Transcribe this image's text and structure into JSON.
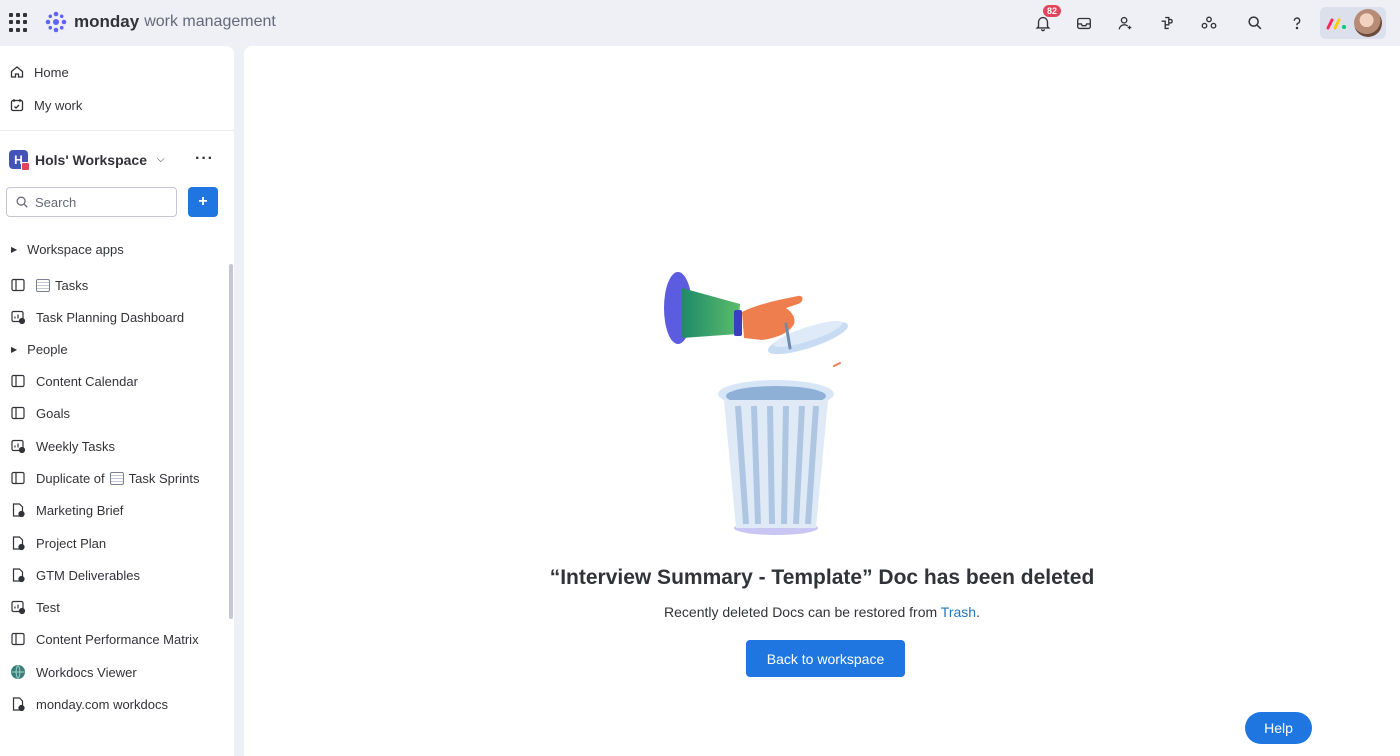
{
  "header": {
    "brand_bold": "monday",
    "brand_light": "work management",
    "notification_count": "82",
    "icons": [
      "apps-grid-icon",
      "bell-icon",
      "inbox-icon",
      "invite-user-icon",
      "integrations-icon",
      "marketplace-icon",
      "search-icon",
      "help-icon"
    ]
  },
  "sidebar": {
    "nav": [
      {
        "label": "Home",
        "icon": "home-icon"
      },
      {
        "label": "My work",
        "icon": "my-work-icon"
      }
    ],
    "workspace": {
      "initial": "H",
      "name": "Hols' Workspace"
    },
    "search": {
      "placeholder": "Search"
    },
    "add_label": "+",
    "items": [
      {
        "label": "Workspace apps",
        "type": "folder"
      },
      {
        "label": "Tasks",
        "type": "board",
        "has_board_emoji": true
      },
      {
        "label": "Task Planning Dashboard",
        "type": "dashboard"
      },
      {
        "label": "People",
        "type": "folder"
      },
      {
        "label": "Content Calendar",
        "type": "board"
      },
      {
        "label": "Goals",
        "type": "board"
      },
      {
        "label": "Weekly Tasks",
        "type": "dashboard"
      },
      {
        "label": "Duplicate of",
        "label2": "Task Sprints",
        "type": "board",
        "has_board_emoji": true
      },
      {
        "label": "Marketing Brief",
        "type": "doc"
      },
      {
        "label": "Project Plan",
        "type": "doc"
      },
      {
        "label": "GTM Deliverables",
        "type": "doc"
      },
      {
        "label": "Test",
        "type": "dashboard"
      },
      {
        "label": "Content Performance Matrix",
        "type": "board"
      },
      {
        "label": "Workdocs Viewer",
        "type": "app"
      },
      {
        "label": "monday.com workdocs",
        "type": "doc"
      }
    ]
  },
  "main": {
    "headline": "“Interview Summary - Template” Doc has been deleted",
    "subtext": "Recently deleted Docs can be restored from ",
    "subtext_link": "Trash",
    "subtext_end": ".",
    "back_button": "Back to workspace",
    "help_button": "Help"
  },
  "colors": {
    "accent": "#1f76e0",
    "badge": "#e2445c",
    "workspace_icon": "#4353b8"
  }
}
